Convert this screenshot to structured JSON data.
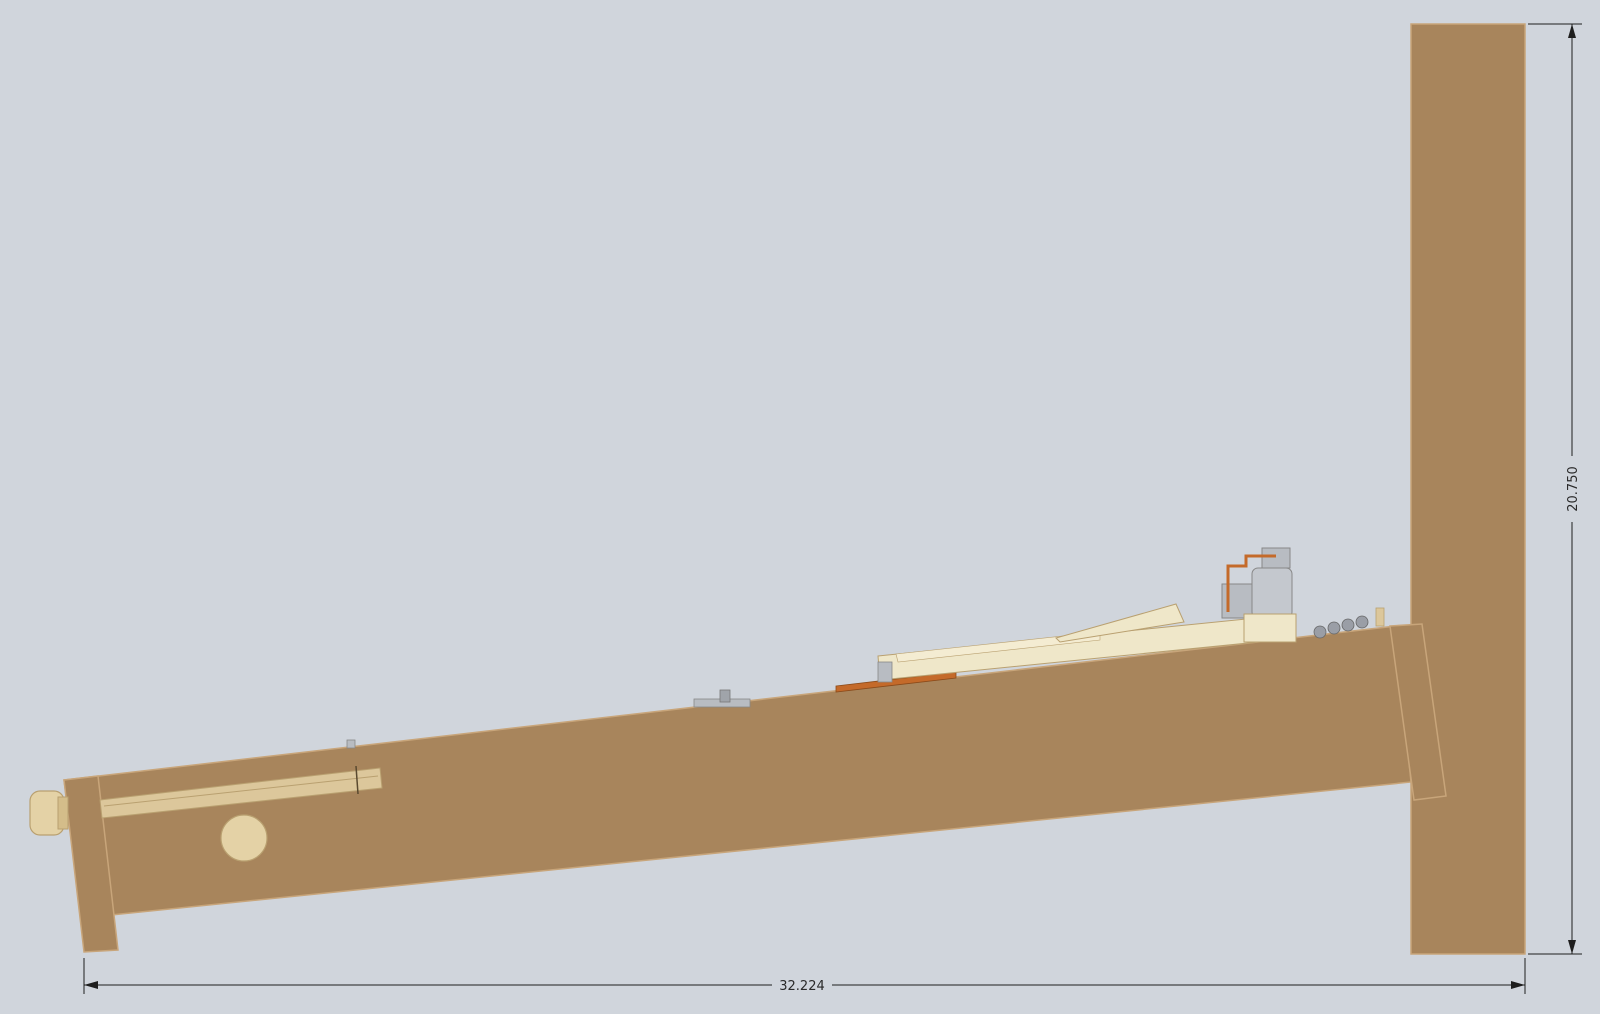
{
  "drawing": {
    "background": "#d0d5dc",
    "colors": {
      "wood": "#a8855c",
      "wood_edge": "#c8a57a",
      "cream": "#efe7c9",
      "brass": "#dcc79b",
      "copper": "#c46a2a",
      "gray_part": "#b8bcc2",
      "dim_line": "#1e1e1e"
    },
    "icons": [
      "side-profile-view"
    ]
  },
  "dimensions": {
    "width_label": "32.224",
    "height_label": "20.750"
  }
}
